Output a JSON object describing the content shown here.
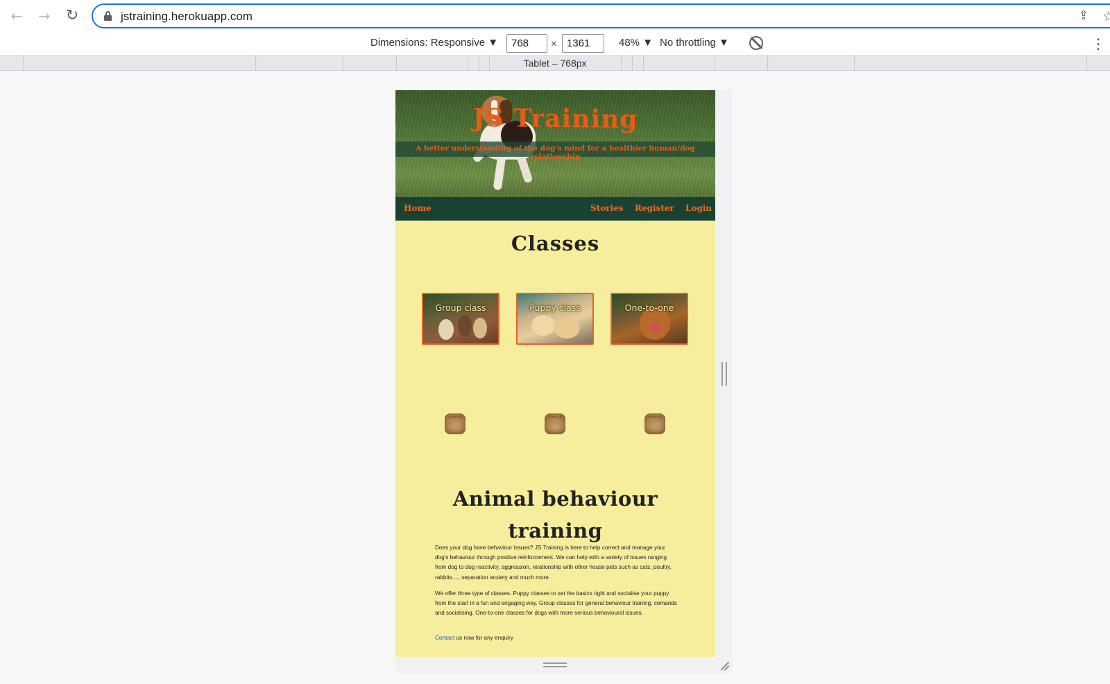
{
  "browser": {
    "url": "jstraining.herokuapp.com",
    "icons": [
      "back-arrow-icon",
      "forward-arrow-icon",
      "reload-icon",
      "lock-icon",
      "share-icon",
      "bookmark-star-icon"
    ]
  },
  "devtools": {
    "dimensions_label": "Dimensions: Responsive ▼",
    "width_value": "768",
    "times": "×",
    "height_value": "1361",
    "zoom_label": "48% ▼",
    "throttle_label": "No throttling ▼",
    "ruler_label": "Tablet – 768px"
  },
  "site": {
    "title": "JS Training",
    "tagline": "A better understanding of the dog's mind for a healthier human/dog relationship",
    "nav": {
      "home": "Home",
      "stories": "Stories",
      "register": "Register",
      "login": "Login"
    },
    "nav_color": "#1a4232",
    "accent_color": "#ec5b12",
    "background_color": "#f6ee9d",
    "classes_heading": "Classes",
    "classes": [
      {
        "label": "Group class"
      },
      {
        "label": "Puppy class"
      },
      {
        "label": "One-to-one"
      }
    ],
    "behaviour_heading_line1": "Animal behaviour",
    "behaviour_heading_line2": "training",
    "paragraph1": "Does your dog have behaviour issues? JS Training is here to help correct and manage your dog's behaviour through positive reinforcement. We can help with a variety of issues ranging from dog to dog reactivity, aggression, relationship with other house pets such as cats, poultry, rabbits...., separation anxiety and much more.",
    "paragraph2": "We offer three type of classes. Puppy classes to set the basics right and socialise your puppy from the start in a fun and engaging way. Group classes for general behaviour training, comands and socialising. One-to-one classes for dogs with more serious behavioural issues.",
    "contact_link": "Contact",
    "contact_rest": " us now for any enquiry"
  }
}
